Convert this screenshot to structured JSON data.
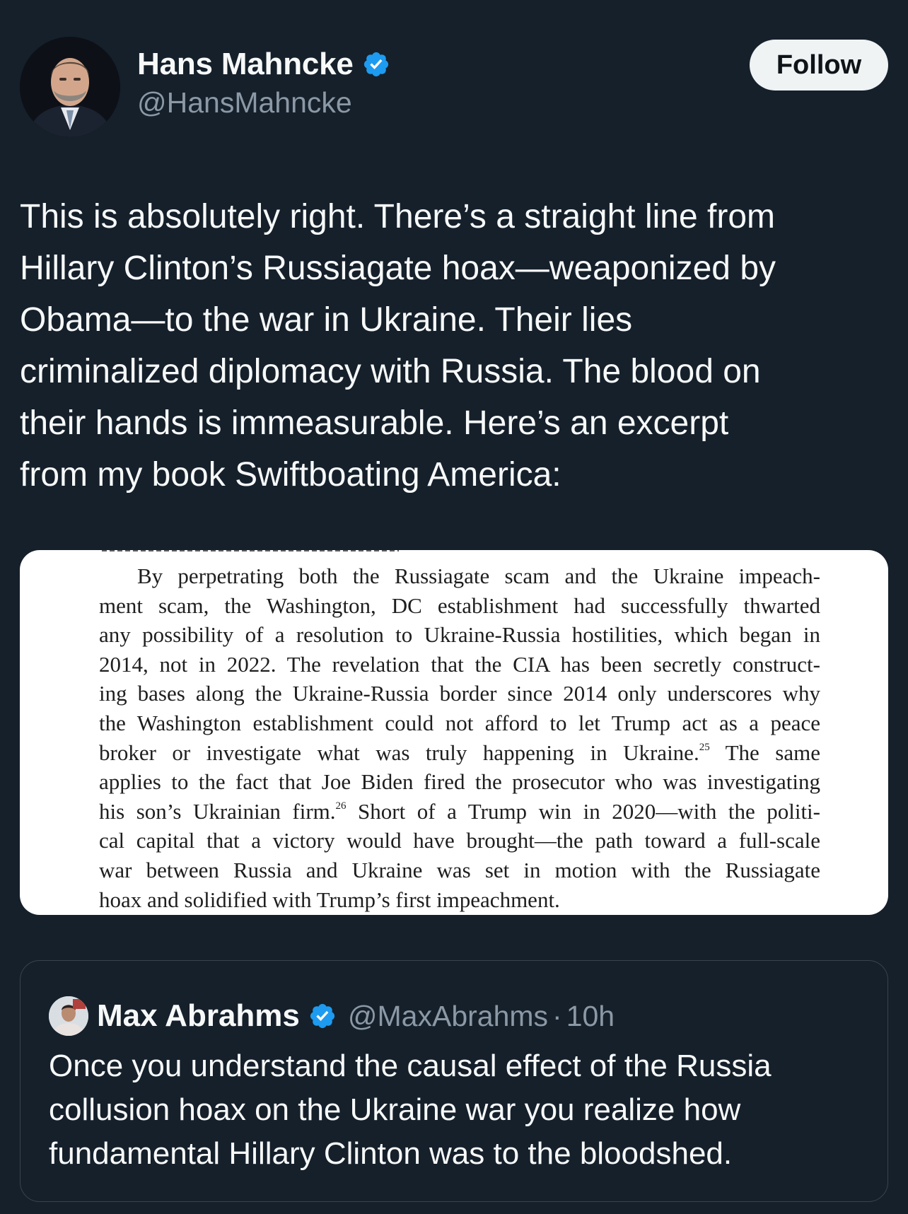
{
  "tweet": {
    "author": {
      "name": "Hans Mahncke",
      "handle": "@HansMahncke",
      "verified": true
    },
    "follow_label": "Follow",
    "text": "This is absolutely right. There’s a straight line from\nHillary Clinton’s Russiagate hoax—weaponized by\nObama—to the war in Ukraine. Their lies\ncriminalized diplomacy with Russia. The blood on\ntheir hands is immeasurable. Here’s an excerpt\nfrom my book Swiftboating America:"
  },
  "book_excerpt": {
    "lines": [
      "By perpetrating both the Russiagate scam and the Ukraine impeach-",
      "ment scam, the Washington, DC establishment had successfully thwarted",
      "any possibility of a resolution to Ukraine-Russia hostilities, which began in",
      "2014, not in 2022. The revelation that the CIA has been secretly construct-",
      "ing bases along the Ukraine-Russia border since 2014 only underscores why",
      "the Washington establishment could not afford to let Trump act as a peace",
      "broker or investigate what was truly happening in Ukraine.",
      "applies to the fact that Joe Biden fired the prosecutor who was investigating",
      "his son’s Ukrainian firm.",
      "cal capital that a victory would have brought—the path toward a full-scale",
      "war between Russia and Ukraine was set in motion with the Russiagate",
      "hoax and solidified with Trump’s first impeachment."
    ],
    "footnote_25": "25",
    "after_25": " The same",
    "footnote_26": "26",
    "after_26": " Short of a Trump win in 2020—with the politi-"
  },
  "quoted_tweet": {
    "author": {
      "name": "Max Abrahms",
      "handle": "@MaxAbrahms",
      "verified": true
    },
    "separator": "·",
    "time": "10h",
    "text": "Once you understand the causal effect of the Russia collusion hoax on the Ukraine war you realize how fundamental Hillary Clinton was to the bloodshed."
  },
  "colors": {
    "background": "#15202b",
    "text_primary": "#f7f9f9",
    "text_secondary": "#8b98a5",
    "verified_badge": "#1d9bf0",
    "border": "#38444d",
    "follow_bg": "#eff3f4"
  },
  "icons": {
    "verified": "verified-badge-icon"
  }
}
